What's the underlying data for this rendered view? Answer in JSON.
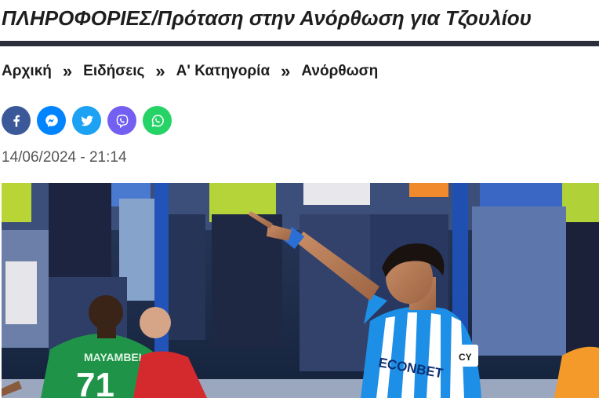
{
  "article": {
    "title": "ΠΛΗΡΟΦΟΡΙΕΣ/Πρόταση στην Ανόρθωση για Τζουλίου",
    "date": "14/06/2024 - 21:14"
  },
  "breadcrumb": {
    "items": [
      "Αρχική",
      "Ειδήσεις",
      "Α' Κατηγορία",
      "Ανόρθωση"
    ],
    "separator": "»"
  },
  "share": [
    {
      "icon": "facebook-icon",
      "color": "#3b5998"
    },
    {
      "icon": "messenger-icon",
      "color": "#0084ff"
    },
    {
      "icon": "twitter-icon",
      "color": "#1da1f2"
    },
    {
      "icon": "viber-icon",
      "color": "#7360f2"
    },
    {
      "icon": "whatsapp-icon",
      "color": "#25d366"
    }
  ],
  "photo": {
    "left_player_name": "MAYAMBELA",
    "left_player_number": "71",
    "sponsor_text": "ECONBET",
    "badge_text": "CY"
  }
}
